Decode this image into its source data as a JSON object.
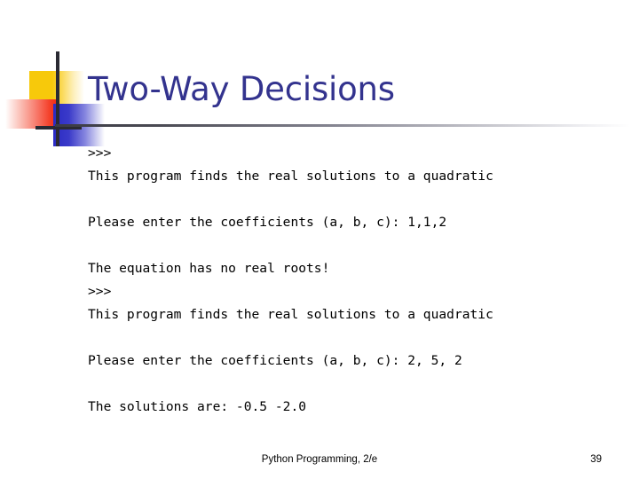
{
  "slide": {
    "title": "Two-Way Decisions",
    "title_color": "#33338E",
    "decoration": {
      "yellow_color": "#F7C90B",
      "red_color": "#F22E15",
      "blue_color": "#2B2BC4",
      "rule_color": "#2A2A33"
    }
  },
  "console": {
    "lines": [
      {
        "id": "prompt-1",
        "text": ">>> "
      },
      {
        "id": "intro-1",
        "text": "This program finds the real solutions to a quadratic"
      },
      {
        "id": "blank-1",
        "text": ""
      },
      {
        "id": "coefficients-1",
        "text": "Please enter the coefficients (a, b, c): 1,1,2"
      },
      {
        "id": "blank-2",
        "text": ""
      },
      {
        "id": "result-1",
        "text": "The equation has no real roots!"
      },
      {
        "id": "prompt-2",
        "text": ">>> "
      },
      {
        "id": "intro-2",
        "text": "This program finds the real solutions to a quadratic"
      },
      {
        "id": "blank-3",
        "text": ""
      },
      {
        "id": "coefficients-2",
        "text": "Please enter the coefficients (a, b, c): 2, 5, 2"
      },
      {
        "id": "blank-4",
        "text": ""
      },
      {
        "id": "result-2",
        "text": "The solutions are: -0.5 -2.0"
      }
    ]
  },
  "footer": {
    "credit": "Python Programming, 2/e",
    "page_number": "39"
  }
}
